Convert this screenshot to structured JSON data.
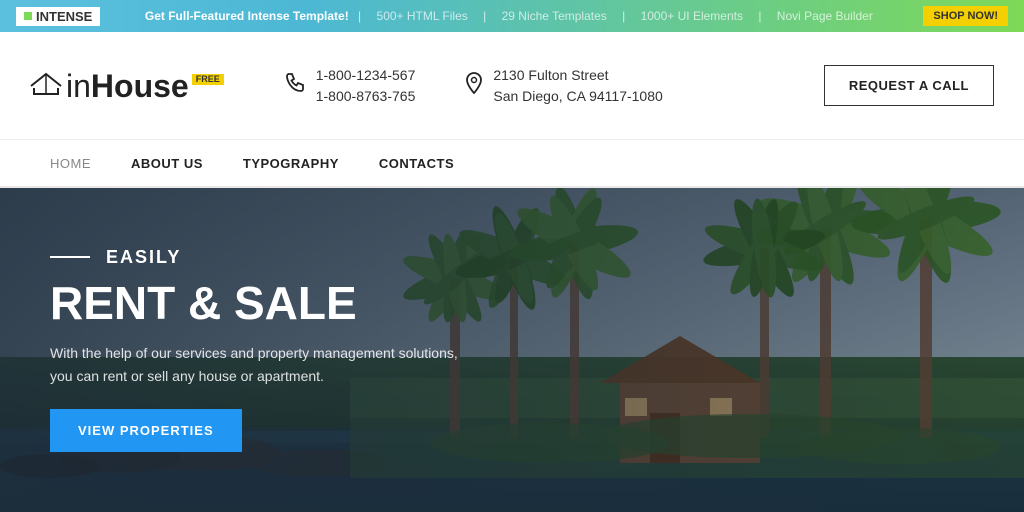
{
  "banner": {
    "logo_text": "INTENSE",
    "message_bold": "Get Full-Featured Intense Template!",
    "feature1": "500+ HTML Files",
    "feature2": "29 Niche Templates",
    "feature3": "1000+ UI Elements",
    "feature4": "Novi Page Builder",
    "shop_now": "SHOP NOW!"
  },
  "header": {
    "logo_in": "in",
    "logo_house": "House",
    "logo_free": "FREE",
    "phone_icon": "📞",
    "phone1": "1-800-1234-567",
    "phone2": "1-800-8763-765",
    "location_icon": "📍",
    "address1": "2130 Fulton Street",
    "address2": "San Diego, CA 94117-1080",
    "request_call": "REQUEST A CALL"
  },
  "nav": {
    "items": [
      {
        "label": "HOME",
        "active": false,
        "bold": false
      },
      {
        "label": "ABOUT US",
        "active": false,
        "bold": true
      },
      {
        "label": "TYPOGRAPHY",
        "active": false,
        "bold": true
      },
      {
        "label": "CONTACTS",
        "active": false,
        "bold": true
      }
    ]
  },
  "hero": {
    "eyebrow": "EASILY",
    "title": "RENT & SALE",
    "description": "With the help of our services and property management solutions, you can rent or sell any house or apartment.",
    "cta": "VIEW PROPERTIES"
  }
}
